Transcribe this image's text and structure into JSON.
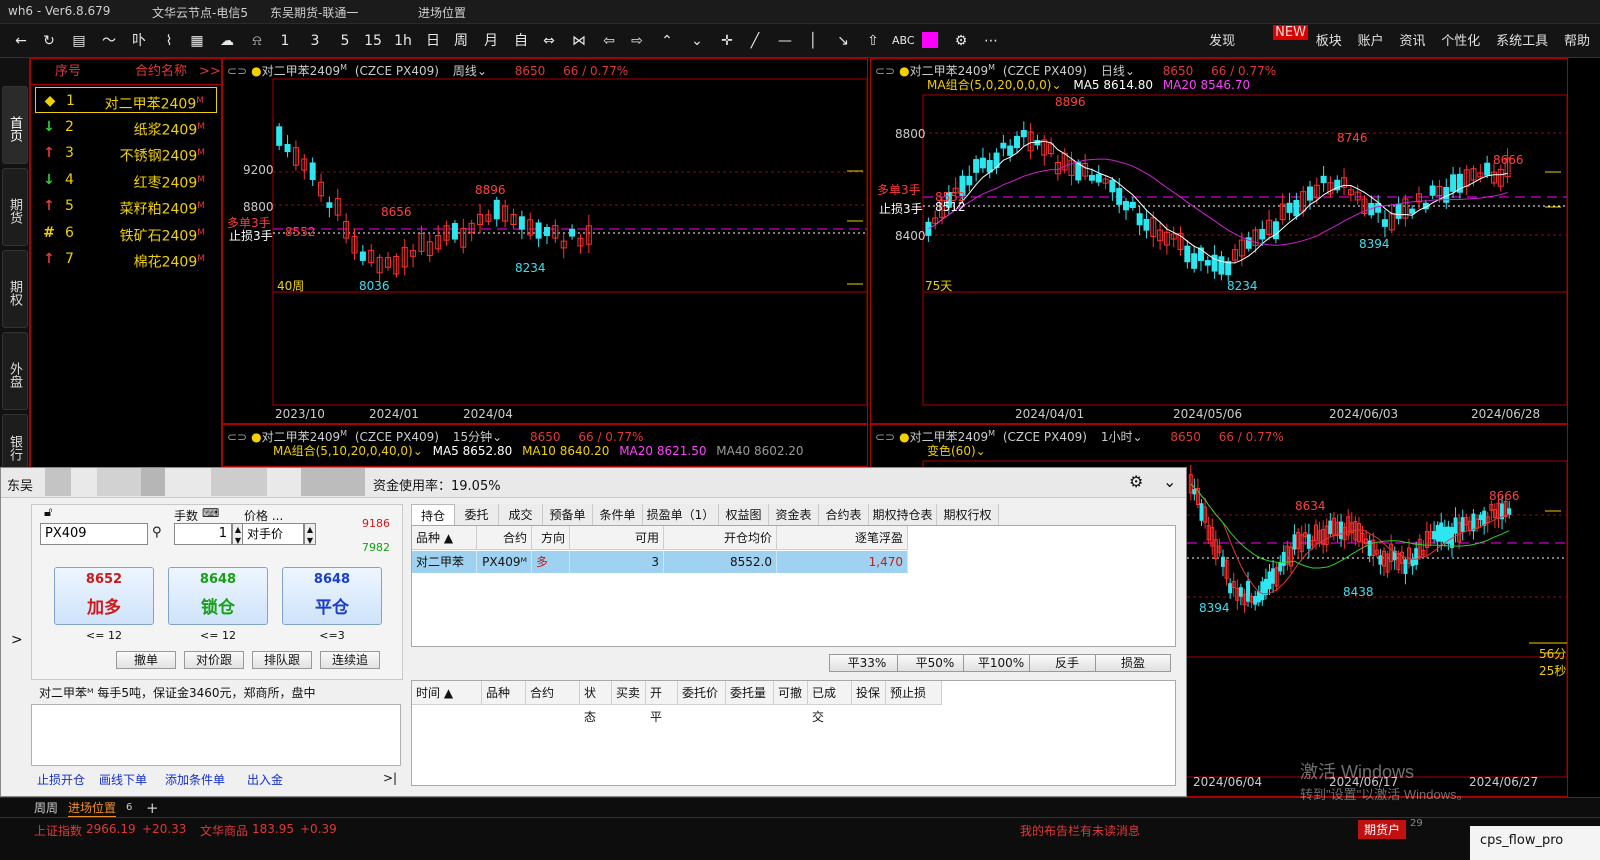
{
  "titlebar": {
    "app_version": "wh6 - Ver6.8.679",
    "node": "文华云节点-电信5",
    "account": "东吴期货-联通一",
    "workspace": "进场位置"
  },
  "menus": {
    "discover": "发现",
    "new_badge": "NEW",
    "sector": "板块",
    "account": "账户",
    "news": "资讯",
    "personalize": "个性化",
    "system": "系统工具",
    "help": "帮助"
  },
  "toolbar": {
    "periods": [
      "1",
      "3",
      "5",
      "15",
      "1h",
      "日",
      "周",
      "月",
      "自"
    ],
    "abc": "ABC"
  },
  "sidetabs": [
    "首页",
    "期货",
    "期权",
    "外盘",
    "银行OTC"
  ],
  "watchlist": {
    "col_index": "序号",
    "col_name": "合约名称",
    "more": ">>",
    "rows": [
      {
        "arrow": "◆",
        "arrow_color": "#f0d000",
        "index": "1",
        "name": "对二甲苯2409",
        "sup": "M"
      },
      {
        "arrow": "↓",
        "arrow_color": "#2fd02f",
        "index": "2",
        "name": "纸浆2409",
        "sup": "M"
      },
      {
        "arrow": "↑",
        "arrow_color": "#e03838",
        "index": "3",
        "name": "不锈钢2409",
        "sup": "M"
      },
      {
        "arrow": "↓",
        "arrow_color": "#2fd02f",
        "index": "4",
        "name": "红枣2409",
        "sup": "M"
      },
      {
        "arrow": "↑",
        "arrow_color": "#e03838",
        "index": "5",
        "name": "菜籽粕2409",
        "sup": "M"
      },
      {
        "arrow": "#",
        "arrow_color": "#f0d000",
        "index": "6",
        "name": "铁矿石2409",
        "sup": "M"
      },
      {
        "arrow": "↑",
        "arrow_color": "#e03838",
        "index": "7",
        "name": "棉花2409",
        "sup": "M"
      }
    ]
  },
  "panels": {
    "weekly": {
      "contract": "对二甲苯2409",
      "sup": "M",
      "code": "(CZCE PX409)",
      "period": "周线",
      "price": "8650",
      "change": "66 / 0.77%",
      "y_ticks": [
        "9200",
        "8800"
      ],
      "annot_long": "多单3手",
      "annot_stop": "止损3手",
      "annot_price": "8552",
      "labels": {
        "hi": "8896",
        "mid": "8656",
        "lo": "8036",
        "lo2": "8234"
      },
      "count": "40周",
      "dates": [
        "2023/10",
        "2024/01",
        "2024/04"
      ]
    },
    "daily": {
      "contract": "对二甲苯2409",
      "sup": "M",
      "code": "(CZCE PX409)",
      "period": "日线",
      "price": "8650",
      "change": "66 / 0.77%",
      "ma_group": "MA组合(5,0,20,0,0,0)",
      "ma5": "MA5 8614.80",
      "ma20": "MA20 8546.70",
      "y_ticks": [
        "8800",
        "8400"
      ],
      "annot_long": "多单3手",
      "annot_stop": "止损3手",
      "annot_price": "8552",
      "annot_price2": "8512",
      "labels": {
        "hi": "8896",
        "mid": "8746",
        "right": "8666",
        "lo": "8234",
        "lo2": "8394"
      },
      "count": "75天",
      "dates": [
        "2024/04/01",
        "2024/05/06",
        "2024/06/03",
        "2024/06/28"
      ]
    },
    "m15": {
      "contract": "对二甲苯2409",
      "sup": "M",
      "code": "(CZCE PX409)",
      "period": "15分钟",
      "price": "8650",
      "change": "66 / 0.77%",
      "ma_group": "MA组合(5,10,20,0,40,0)",
      "ma5": "MA5 8652.80",
      "ma10": "MA10 8640.20",
      "ma20": "MA20 8621.50",
      "ma40": "MA40 8602.20"
    },
    "h1": {
      "contract": "对二甲苯2409",
      "sup": "M",
      "code": "(CZCE PX409)",
      "period": "1小时",
      "price": "8650",
      "change": "66 / 0.77%",
      "indicator": "变色(60)",
      "labels": {
        "a": "8634",
        "b": "8666",
        "c": "8438",
        "d": "8394"
      },
      "timer": "56分25秒",
      "dates": [
        "2024/06/04",
        "2024/06/17",
        "2024/06/27"
      ]
    }
  },
  "trade": {
    "title_prefix": "东吴",
    "fund_usage": "资金使用率：19.05%",
    "symbol": "PX409",
    "qty_label": "手数",
    "qty": "1",
    "price_label": "价格 ...",
    "price_mode": "对手价",
    "limit_up": "9186",
    "limit_down": "7982",
    "buttons": [
      {
        "price": "8652",
        "label": "加多",
        "limit": "<= 12",
        "color": "#d01818"
      },
      {
        "price": "8648",
        "label": "锁仓",
        "limit": "<= 12",
        "color": "#16a016"
      },
      {
        "price": "8648",
        "label": "平仓",
        "limit": "<=3",
        "color": "#1a3ec8"
      }
    ],
    "small_buttons": [
      "撤单",
      "对价跟",
      "排队跟",
      "连续追"
    ],
    "info": "对二甲苯ᴹ 每手5吨，保证金3460元，郑商所，盘中",
    "links": [
      "止损开仓",
      "画线下单",
      "添加条件单",
      "出入金"
    ],
    "collapse": ">|",
    "expand": ">",
    "tabs": [
      "持仓",
      "委托",
      "成交",
      "预备单",
      "条件单",
      "损盈单（1）",
      "权益图",
      "资金表",
      "合约表",
      "期权持仓表",
      "期权行权"
    ],
    "pos_headers": [
      "品种 ▲",
      "合约",
      "方向",
      "可用",
      "开仓均价",
      "逐笔浮盈"
    ],
    "pos_row": {
      "product": "对二甲苯",
      "contract": "PX409ᴹ",
      "direction": "多",
      "avail": "3",
      "avg": "8552.0",
      "pnl": "1,470"
    },
    "action_buttons": [
      "平33%",
      "平50%",
      "平100%",
      "反手",
      "损盈"
    ],
    "order_headers": [
      "时间 ▲",
      "品种",
      "合约",
      "状态",
      "买卖",
      "开平",
      "委托价",
      "委托量",
      "可撤",
      "已成交",
      "投保",
      "预止损"
    ]
  },
  "bottom_tabs": {
    "tab1": "周周",
    "tab2": "进场位置",
    "count": "6",
    "add": "+"
  },
  "status": {
    "idx1_name": "上证指数",
    "idx1_val": "2966.19",
    "idx1_chg": "+20.33",
    "idx2_name": "文华商品",
    "idx2_val": "183.95",
    "idx2_chg": "+0.39",
    "notice": "我的布告栏有未读消息",
    "futures": "期货户",
    "task": "cps_flow_pro",
    "task_num": "29"
  },
  "watermark": {
    "line1": "激活 Windows",
    "line2": "转到\"设置\"以激活 Windows。"
  }
}
